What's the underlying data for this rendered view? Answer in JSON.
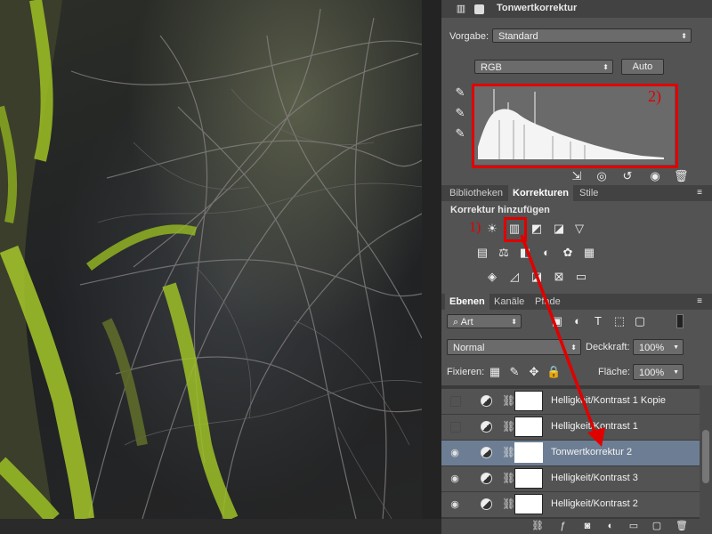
{
  "properties_panel": {
    "title": "Tonwertkorrektur",
    "preset_label": "Vorgabe:",
    "preset_value": "Standard",
    "channel_value": "RGB",
    "auto_label": "Auto"
  },
  "annotations": {
    "one": "1)",
    "two": "2)",
    "highlight_color": "#e00000"
  },
  "adjustments_panel": {
    "tabs": [
      "Bibliotheken",
      "Korrekturen",
      "Stile"
    ],
    "active_tab": "Korrekturen",
    "heading": "Korrektur hinzufügen"
  },
  "layers_panel": {
    "tabs": [
      "Ebenen",
      "Kanäle",
      "Pfade"
    ],
    "active_tab": "Ebenen",
    "filter_value": "Art",
    "blend_mode": "Normal",
    "opacity_label": "Deckkraft:",
    "opacity_value": "100%",
    "lock_label": "Fixieren:",
    "fill_label": "Fläche:",
    "fill_value": "100%",
    "layers": [
      {
        "name": "Helligkeit/Kontrast 1 Kopie",
        "visible": false,
        "selected": false
      },
      {
        "name": "Helligkeit/Kontrast 1",
        "visible": false,
        "selected": false
      },
      {
        "name": "Tonwertkorrektur 2",
        "visible": true,
        "selected": true
      },
      {
        "name": "Helligkeit/Kontrast 3",
        "visible": true,
        "selected": false
      },
      {
        "name": "Helligkeit/Kontrast 2",
        "visible": true,
        "selected": false
      }
    ]
  }
}
